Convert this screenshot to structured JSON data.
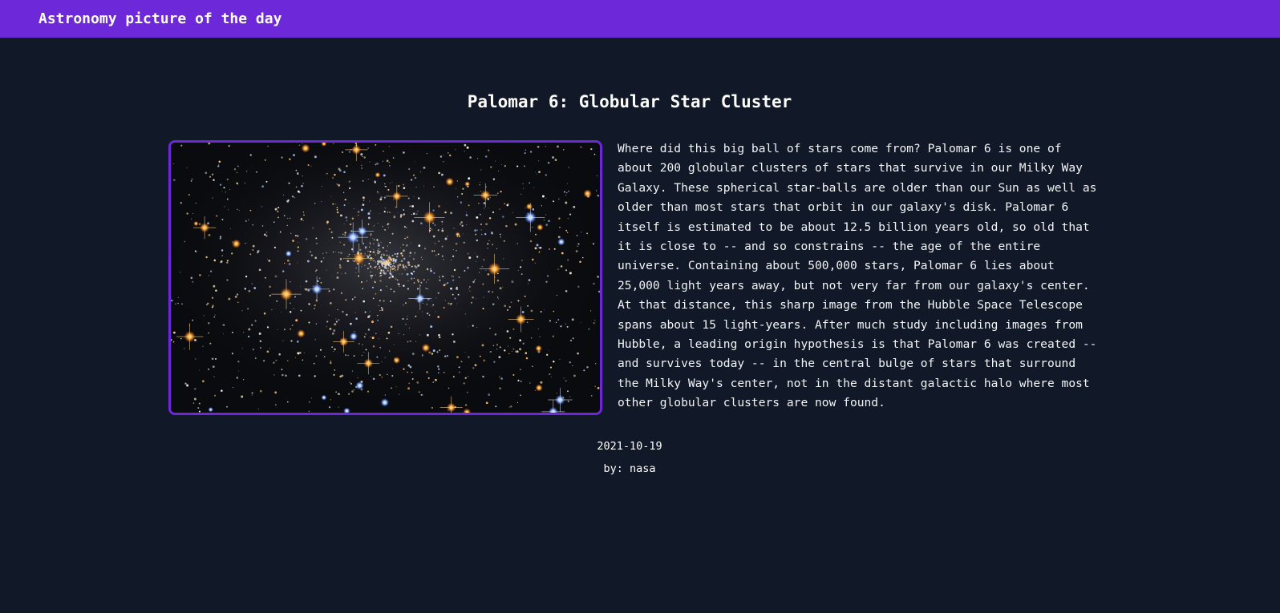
{
  "header": {
    "title": "Astronomy picture of the day"
  },
  "apod": {
    "title": "Palomar 6: Globular Star Cluster",
    "explanation": "Where did this big ball of stars come from? Palomar 6 is one of about 200 globular clusters of stars that survive in our Milky Way Galaxy. These spherical star-balls are older than our Sun as well as older than most stars that orbit in our galaxy's disk. Palomar 6 itself is estimated to be about 12.5 billion years old, so old that it is close to -- and so constrains -- the age of the entire universe. Containing about 500,000 stars, Palomar 6 lies about 25,000 light years away, but not very far from our galaxy's center. At that distance, this sharp image from the Hubble Space Telescope spans about 15 light-years. After much study including images from Hubble, a leading origin hypothesis is that Palomar 6 was created -- and survives today -- in the central bulge of stars that surround the Milky Way's center, not in the distant galactic halo where most other globular clusters are now found.",
    "date": "2021-10-19",
    "by_label": "by:",
    "author": "nasa"
  },
  "colors": {
    "accent": "#6d28d9",
    "background": "#111827",
    "text": "#ffffff"
  },
  "image": {
    "icon": "star-cluster-photo"
  }
}
